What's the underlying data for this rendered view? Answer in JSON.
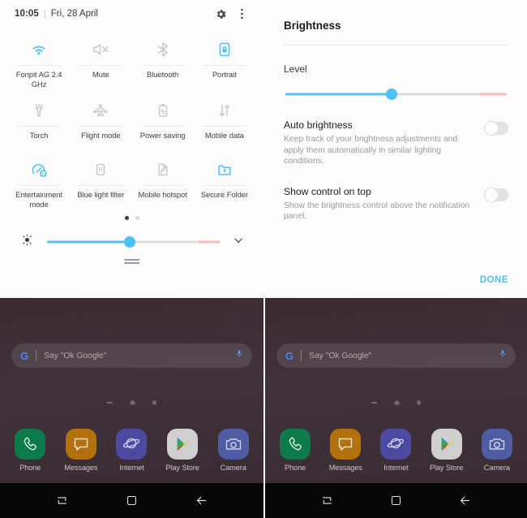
{
  "colors": {
    "accent_blue": "#4fc0f5",
    "slider_fill": "#5bc0f0",
    "slider_warn": "#f9b9ba",
    "slider_track": "#dcdcdc",
    "done_blue": "#56bde6",
    "wallpaper": "#3b2b31",
    "navbar": "#060606",
    "tile_active": "#4fc0f5",
    "tile_inactive": "#c8c8c8"
  },
  "left_panel": {
    "status_bar": {
      "time": "10:05",
      "separator": "|",
      "date": "Fri, 28 April",
      "settings_icon": "gear-icon",
      "overflow_icon": "kebab-menu-icon"
    },
    "tiles": [
      {
        "icon": "wifi-icon",
        "label": "Fonpit AG 2.4 GHz",
        "state": "on"
      },
      {
        "icon": "volume-mute-icon",
        "label": "Mute",
        "state": "off"
      },
      {
        "icon": "bluetooth-icon",
        "label": "Bluetooth",
        "state": "off"
      },
      {
        "icon": "screen-rotation-lock-icon",
        "label": "Portrait",
        "state": "on"
      },
      {
        "icon": "torch-icon",
        "label": "Torch",
        "state": "off"
      },
      {
        "icon": "airplane-icon",
        "label": "Flight mode",
        "state": "off"
      },
      {
        "icon": "battery-saving-icon",
        "label": "Power saving",
        "state": "off"
      },
      {
        "icon": "mobile-data-icon",
        "label": "Mobile data",
        "state": "off"
      },
      {
        "icon": "entertainment-mode-icon",
        "label": "Entertainment mode",
        "state": "on"
      },
      {
        "icon": "blue-light-filter-icon",
        "label": "Blue light filter",
        "state": "off"
      },
      {
        "icon": "mobile-hotspot-icon",
        "label": "Mobile hotspot",
        "state": "off"
      },
      {
        "icon": "secure-folder-icon",
        "label": "Secure Folder",
        "state": "on"
      }
    ],
    "page_indicator": {
      "pages": 2,
      "active_index": 0
    },
    "brightness_row": {
      "icon": "brightness-sun-icon",
      "level_percent": 48,
      "warn_start_percent": 88,
      "expand_icon": "chevron-down-icon"
    },
    "panel_handle": "drag-handle"
  },
  "right_panel": {
    "dialog": {
      "title": "Brightness",
      "level_label": "Level",
      "level_percent": 48,
      "warn_start_percent": 88,
      "options": [
        {
          "title": "Auto brightness",
          "description": "Keep track of your brightness adjustments and apply them automatically in similar lighting conditions.",
          "toggle_state": "off"
        },
        {
          "title": "Show control on top",
          "description": "Show the brightness control above the notification panel.",
          "toggle_state": "off"
        }
      ],
      "done_label": "DONE"
    }
  },
  "home_screen": {
    "search_bar": {
      "logo": "google-g-logo",
      "placeholder": "Say \"Ok Google\"",
      "mic_icon": "microphone-icon"
    },
    "page_dots": {
      "items": [
        "dash",
        "home-icon",
        "dot"
      ]
    },
    "dock_apps": [
      {
        "name": "Phone",
        "icon": "phone-handset-icon",
        "color": "#0d7a4b"
      },
      {
        "name": "Messages",
        "icon": "message-bubble-icon",
        "color": "#b3700e"
      },
      {
        "name": "Internet",
        "icon": "saturn-browser-icon",
        "color": "#4b4aa0"
      },
      {
        "name": "Play Store",
        "icon": "play-store-icon",
        "color": "#cfcfcf"
      },
      {
        "name": "Camera",
        "icon": "camera-icon",
        "color": "#4f5ba3"
      }
    ],
    "nav_bar": [
      {
        "name": "Recents",
        "icon": "recents-icon"
      },
      {
        "name": "Home",
        "icon": "home-square-icon"
      },
      {
        "name": "Back",
        "icon": "back-arrow-icon"
      }
    ]
  }
}
